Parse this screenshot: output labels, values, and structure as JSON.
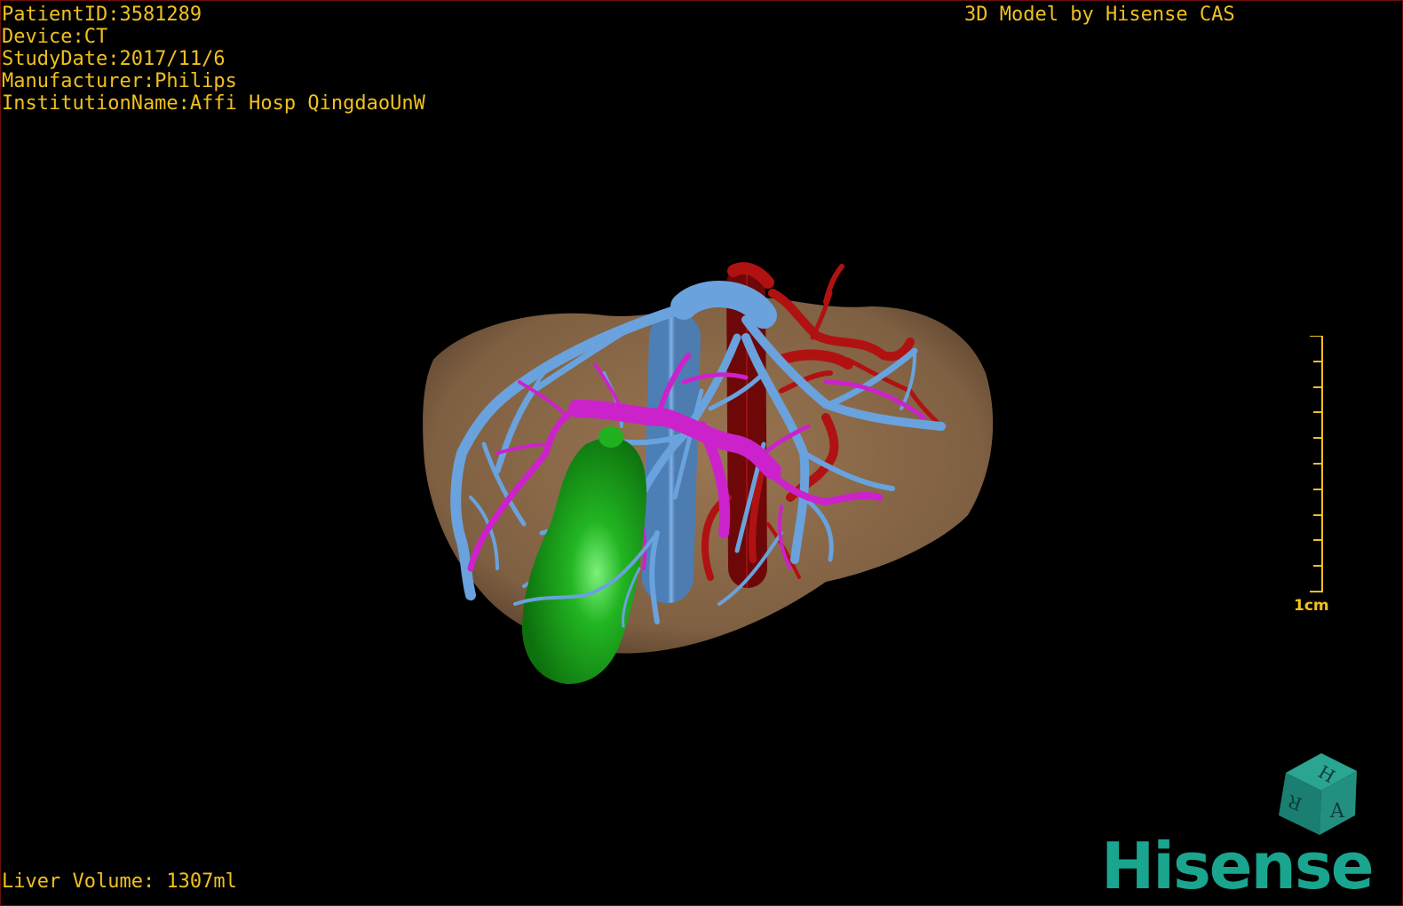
{
  "patient": {
    "patient_id": "PatientID:3581289",
    "device": "Device:CT",
    "study_date": "StudyDate:2017/11/6",
    "manufacturer": "Manufacturer:Philips",
    "institution": "InstitutionName:Affi Hosp QingdaoUnW"
  },
  "header": {
    "title": "3D Model by Hisense CAS"
  },
  "footer": {
    "liver_volume": "Liver Volume: 1307ml"
  },
  "scale": {
    "label": "1cm"
  },
  "orientation_cube": {
    "labels": [
      "H",
      "R",
      "A"
    ]
  },
  "brand": {
    "logo_text": "Hisense"
  },
  "colors": {
    "overlay_text": "#f0c020",
    "liver": "#8b6a47",
    "gallbladder": "#1fa81f",
    "hepatic_vein": "#6aa2dd",
    "portal_vein": "#cc22cc",
    "artery": "#aa1010",
    "brand": "#1aa58f"
  },
  "structures": [
    "liver",
    "gallbladder",
    "hepatic-vein",
    "portal-vein",
    "artery"
  ]
}
